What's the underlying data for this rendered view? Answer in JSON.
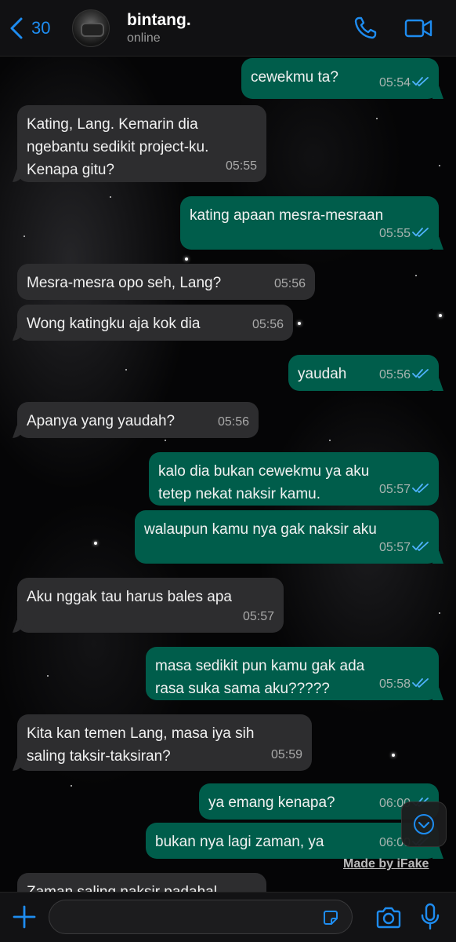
{
  "header": {
    "back_count": "30",
    "contact_name": "bintang.",
    "contact_status": "online"
  },
  "messages": [
    {
      "dir": "out",
      "text": "cewekmu ta?",
      "time": "05:54",
      "read": true
    },
    {
      "dir": "in",
      "text": "Kating, Lang. Kemarin dia\nngebantu sedikit project-ku.\nKenapa gitu?",
      "time": "05:55"
    },
    {
      "dir": "out",
      "text": "kating apaan mesra-mesraan",
      "time": "05:55",
      "read": true
    },
    {
      "dir": "in",
      "text": "Mesra-mesra opo seh, Lang?",
      "time": "05:56"
    },
    {
      "dir": "in",
      "text": "Wong katingku aja kok dia",
      "time": "05:56"
    },
    {
      "dir": "out",
      "text": "yaudah",
      "time": "05:56",
      "read": true
    },
    {
      "dir": "in",
      "text": "Apanya yang yaudah?",
      "time": "05:56"
    },
    {
      "dir": "out",
      "text": "kalo dia bukan cewekmu ya aku\ntetep nekat naksir kamu.",
      "time": "05:57",
      "read": true
    },
    {
      "dir": "out",
      "text": "walaupun kamu nya gak naksir aku",
      "time": "05:57",
      "read": true
    },
    {
      "dir": "in",
      "text": "Aku nggak tau harus bales apa",
      "time": "05:57"
    },
    {
      "dir": "out",
      "text": "masa sedikit pun kamu gak ada\nrasa suka sama aku?????",
      "time": "05:58",
      "read": true
    },
    {
      "dir": "in",
      "text": "Kita kan temen Lang, masa iya sih\nsaling taksir-taksiran?",
      "time": "05:59"
    },
    {
      "dir": "out",
      "text": "ya emang kenapa?",
      "time": "06:00",
      "read": true
    },
    {
      "dir": "out",
      "text": "bukan nya lagi zaman, ya",
      "time": "06:00",
      "read": true
    },
    {
      "dir": "in",
      "text": "Zaman saling naksir padahal",
      "time": ""
    }
  ],
  "watermark": "Made by iFake",
  "input": {
    "placeholder": "",
    "value": ""
  },
  "colors": {
    "accent": "#1e8cf0",
    "outgoing_bubble": "#005d4b",
    "incoming_bubble": "#2d2d2f",
    "read_ticks": "#4fb3ff"
  },
  "icons": [
    "back-chevron-icon",
    "phone-icon",
    "video-camera-icon",
    "scroll-down-chevron-icon",
    "plus-icon",
    "sticker-icon",
    "camera-icon",
    "microphone-icon"
  ]
}
